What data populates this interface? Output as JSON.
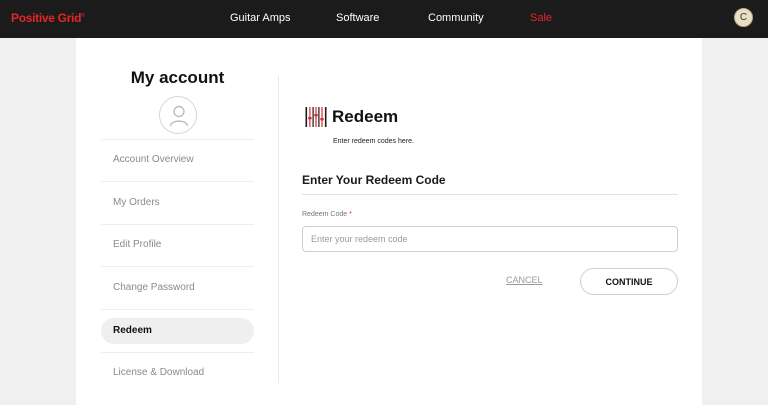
{
  "brand": {
    "logo_text": "Positive Grid",
    "logo_color": "#e4262b"
  },
  "nav": {
    "links": [
      {
        "label": "Guitar Amps"
      },
      {
        "label": "Software"
      },
      {
        "label": "Community"
      },
      {
        "label": "Sale",
        "color": "#e4262b"
      }
    ],
    "user_initial": "C"
  },
  "sidebar": {
    "title": "My account",
    "avatar_icon": "user-icon",
    "items": [
      {
        "label": "Account Overview",
        "active": false
      },
      {
        "label": "My Orders",
        "active": false
      },
      {
        "label": "Edit Profile",
        "active": false
      },
      {
        "label": "Change Password",
        "active": false
      },
      {
        "label": "Redeem",
        "active": true
      },
      {
        "label": "License & Download",
        "active": false
      }
    ]
  },
  "main": {
    "icon": "redeem-barcode-icon",
    "title": "Redeem",
    "subtitle": "Enter redeem codes here.",
    "section_title": "Enter Your Redeem Code",
    "field": {
      "label": "Redeem Code",
      "required_mark": "*",
      "value": "",
      "placeholder": "Enter your redeem code"
    },
    "cancel_label": "CANCEL",
    "continue_label": "CONTINUE"
  },
  "colors": {
    "topbar": "#1b1b1b",
    "page_bg": "#f0f0f0",
    "accent": "#e4262b"
  }
}
